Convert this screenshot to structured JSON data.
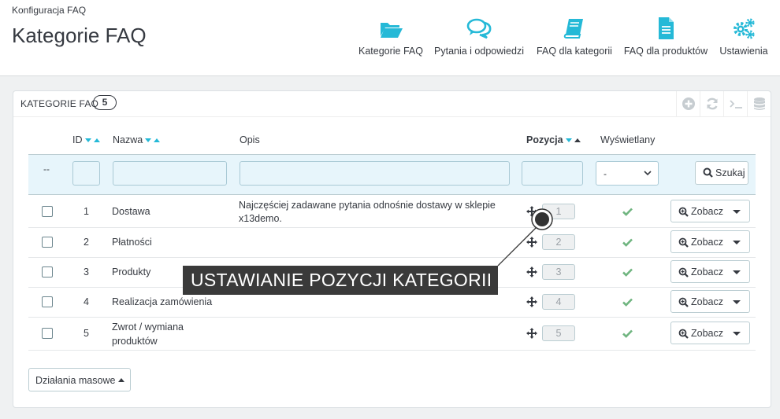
{
  "header": {
    "breadcrumb": "Konfiguracja FAQ",
    "title": "Kategorie FAQ",
    "toolbar": [
      {
        "label": "Kategorie FAQ",
        "icon": "folder-open-icon"
      },
      {
        "label": "Pytania i odpowiedzi",
        "icon": "chat-bubbles-icon"
      },
      {
        "label": "FAQ dla kategorii",
        "icon": "book-icon"
      },
      {
        "label": "FAQ dla produktów",
        "icon": "document-icon"
      },
      {
        "label": "Ustawienia",
        "icon": "gears-icon"
      }
    ]
  },
  "panel": {
    "title": "KATEGORIE FAQ",
    "count": "5",
    "tools": [
      "add-icon",
      "refresh-icon",
      "terminal-icon",
      "database-icon"
    ]
  },
  "table": {
    "columns": {
      "id": "ID",
      "name": "Nazwa",
      "description": "Opis",
      "position": "Pozycja",
      "displayed": "Wyświetlany"
    },
    "filter": {
      "dash": "--",
      "displayed_value": "-",
      "search_label": "Szukaj"
    },
    "rows": [
      {
        "id": "1",
        "name": "Dostawa",
        "description": "Najczęściej zadawane pytania odnośnie dostawy w sklepie x13demo.",
        "position": "1",
        "displayed": true,
        "action": "Zobacz"
      },
      {
        "id": "2",
        "name": "Płatności",
        "description": "",
        "position": "2",
        "displayed": true,
        "action": "Zobacz"
      },
      {
        "id": "3",
        "name": "Produkty",
        "description": "",
        "position": "3",
        "displayed": true,
        "action": "Zobacz"
      },
      {
        "id": "4",
        "name": "Realizacja zamówienia",
        "description": "",
        "position": "4",
        "displayed": true,
        "action": "Zobacz"
      },
      {
        "id": "5",
        "name": "Zwrot / wymiana produktów",
        "description": "",
        "position": "5",
        "displayed": true,
        "action": "Zobacz"
      }
    ]
  },
  "bulk_actions": "Działania masowe",
  "annotation": "USTAWIANIE POZYCJI KATEGORII",
  "colors": {
    "accent": "#25b9d7",
    "check": "#70b580",
    "callout": "#3a3a3a"
  }
}
